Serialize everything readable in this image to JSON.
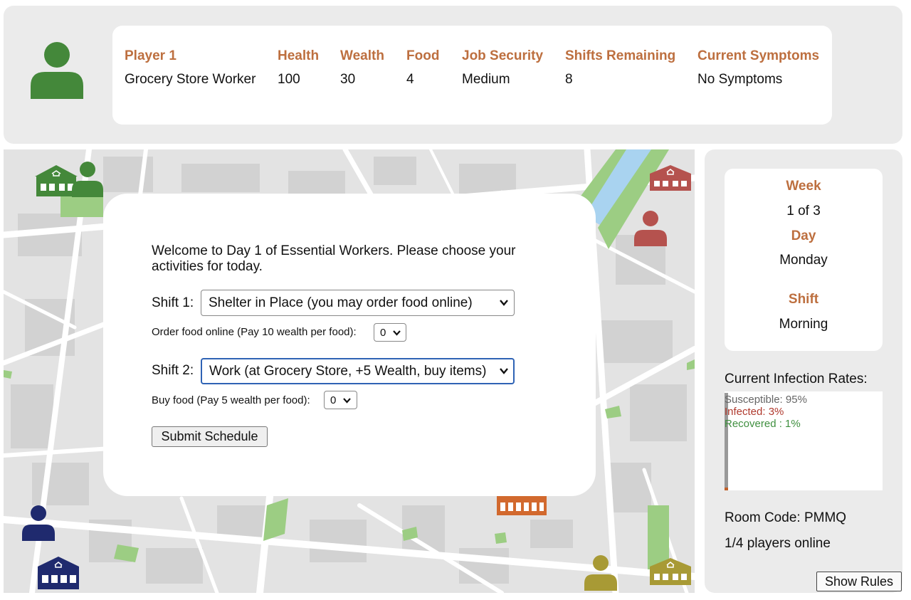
{
  "player": {
    "name": "Player 1",
    "role": "Grocery Store Worker",
    "avatar_color": "#44883a"
  },
  "stats": [
    {
      "label": "Health",
      "value": "100"
    },
    {
      "label": "Wealth",
      "value": "30"
    },
    {
      "label": "Food",
      "value": "4"
    },
    {
      "label": "Job Security",
      "value": "Medium"
    },
    {
      "label": "Shifts Remaining",
      "value": "8"
    },
    {
      "label": "Current Symptoms",
      "value": "No Symptoms"
    }
  ],
  "dialog": {
    "welcome": "Welcome to Day 1 of Essential Workers. Please choose your activities for today.",
    "shift1_label": "Shift 1:",
    "shift1_selected": "Shelter in Place (you may order food online)",
    "order_food_label": "Order food online (Pay 10 wealth per food):",
    "order_food_value": "0",
    "shift2_label": "Shift 2:",
    "shift2_selected": "Work (at Grocery Store, +5 Wealth, buy items)",
    "buy_food_label": "Buy food (Pay 5 wealth per food):",
    "buy_food_value": "0",
    "submit_label": "Submit Schedule"
  },
  "time": {
    "week_label": "Week",
    "week_value": "1 of 3",
    "day_label": "Day",
    "day_value": "Monday",
    "shift_label": "Shift",
    "shift_value": "Morning"
  },
  "infection": {
    "title": "Current Infection Rates:",
    "susceptible": "Susceptible: 95%",
    "infected": "Infected: 3%",
    "recovered": "Recovered : 1%",
    "colors": {
      "susceptible": "#888888",
      "infected": "#c0392b",
      "recovered": "#3f8f3f"
    }
  },
  "room": {
    "code_text": "Room Code: PMMQ",
    "players_online": "1/4 players online"
  },
  "rules_button": "Show Rules",
  "map_markers": {
    "green": "#44883a",
    "red": "#b5524e",
    "navy": "#1f2a6e",
    "olive": "#a89a35",
    "orange": "#d2692e"
  }
}
